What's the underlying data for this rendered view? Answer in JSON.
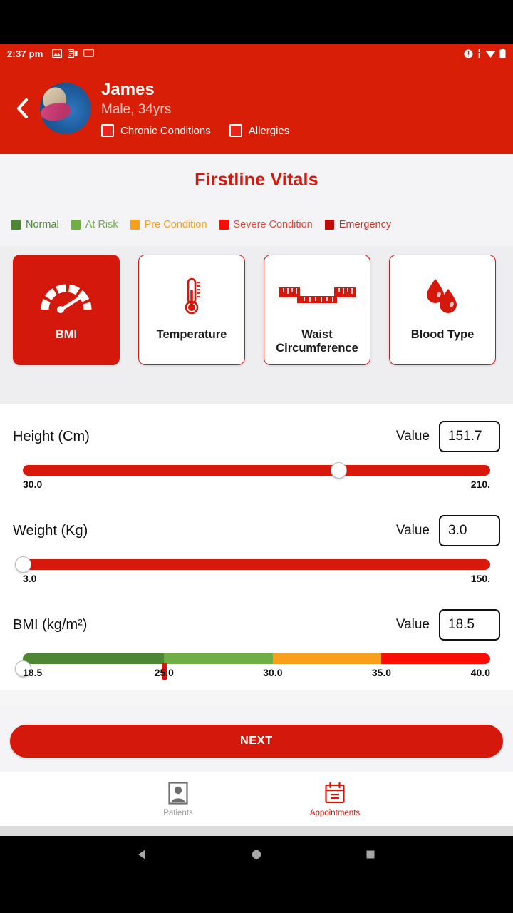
{
  "statusbar": {
    "time": "2:37 pm",
    "left_icons": [
      "image-icon",
      "document-icon",
      "cast-screen-icon"
    ],
    "right_icons": [
      "alarm-warning-icon",
      "signal-icon",
      "wifi-icon",
      "battery-icon"
    ]
  },
  "header": {
    "back_label": "back-chevron",
    "patient_name": "James",
    "patient_meta": "Male, 34yrs",
    "flags": [
      {
        "label": "Chronic Conditions",
        "checked": false
      },
      {
        "label": "Allergies",
        "checked": false
      }
    ],
    "bg_color": "#D81E06"
  },
  "page": {
    "title": "Firstline Vitals",
    "title_color": "#D4180B"
  },
  "legend": {
    "items": [
      {
        "label": "Normal",
        "color": "#4E8733"
      },
      {
        "label": "At Risk",
        "color": "#6FAE45"
      },
      {
        "label": "Pre Condition",
        "color": "#F9A01B"
      },
      {
        "label": "Severe Condition",
        "color": "#FB0D04"
      },
      {
        "label": "Emergency",
        "color": "#BE0C09"
      }
    ]
  },
  "vitals_cards": [
    {
      "label": "BMI",
      "icon": "gauge-icon",
      "selected": true
    },
    {
      "label": "Temperature",
      "icon": "thermometer-icon",
      "selected": false
    },
    {
      "label": "Waist\nCircumference",
      "icon": "tape-measure-icon",
      "selected": false
    },
    {
      "label": "Blood\nType",
      "icon": "blood-drop-icon",
      "selected": false
    }
  ],
  "sliders": [
    {
      "label": "Height (Cm)",
      "value_word": "Value",
      "value": "151.7",
      "min_label": "30.0",
      "max_label": "210.",
      "min": 30,
      "max": 210,
      "current": 151.7,
      "track_color": "#D8180B",
      "zones": []
    },
    {
      "label": "Weight (Kg)",
      "value_word": "Value",
      "value": "3.0",
      "min_label": "3.0",
      "max_label": "150.",
      "min": 3,
      "max": 150,
      "current": 3.0,
      "track_color": "#D8180B",
      "zones": []
    },
    {
      "label": "BMI (kg/m²)",
      "value_word": "Value",
      "value": "18.5",
      "min_label": "18.5",
      "max_label": "40.0",
      "min": 18.5,
      "max": 40.0,
      "current": 18.5,
      "marker": 25.0,
      "track_color": "",
      "zones": [
        {
          "from": 18.5,
          "to": 25.0,
          "color": "#4E8733"
        },
        {
          "from": 25.0,
          "to": 30.0,
          "color": "#6FAE45"
        },
        {
          "from": 30.0,
          "to": 35.0,
          "color": "#F9A01B"
        },
        {
          "from": 35.0,
          "to": 40.0,
          "color": "#FB0D04"
        }
      ],
      "scale_ticks": [
        "18.5",
        "25.0",
        "30.0",
        "35.0",
        "40.0"
      ]
    }
  ],
  "next_button": {
    "label": "NEXT"
  },
  "bottom_nav": [
    {
      "label": "Patients",
      "icon": "person-photo-icon",
      "active": false
    },
    {
      "label": "Appointments",
      "icon": "calendar-icon",
      "active": true
    }
  ],
  "android_nav": [
    {
      "name": "back-triangle-icon"
    },
    {
      "name": "home-circle-icon"
    },
    {
      "name": "recents-square-icon"
    }
  ]
}
